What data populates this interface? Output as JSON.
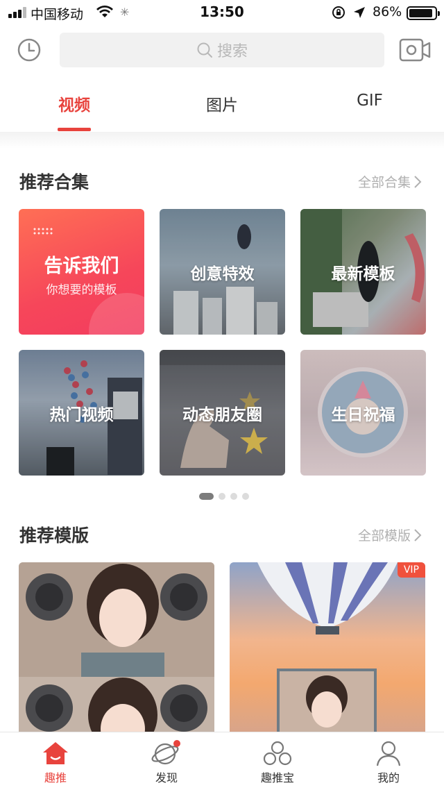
{
  "status_bar": {
    "carrier": "中国移动",
    "time": "13:50",
    "battery": "86%"
  },
  "search": {
    "placeholder": "搜索"
  },
  "tabs": [
    {
      "label": "视频",
      "active": true
    },
    {
      "label": "图片",
      "active": false
    },
    {
      "label": "GIF",
      "active": false
    }
  ],
  "collections": {
    "title": "推荐合集",
    "more": "全部合集",
    "feedback_card": {
      "title": "告诉我们",
      "subtitle": "你想要的模板"
    },
    "items": [
      {
        "label": "创意特效"
      },
      {
        "label": "最新模板"
      },
      {
        "label": "热门视频"
      },
      {
        "label": "动态朋友圈"
      },
      {
        "label": "生日祝福"
      }
    ],
    "page_count": 4,
    "current_page": 1
  },
  "templates": {
    "title": "推荐模版",
    "more": "全部模版",
    "badge": "VIP"
  },
  "bottom_nav": [
    {
      "label": "趣推",
      "icon": "home-icon",
      "active": true
    },
    {
      "label": "发现",
      "icon": "planet-icon",
      "active": false
    },
    {
      "label": "趣推宝",
      "icon": "circles-icon",
      "active": false
    },
    {
      "label": "我的",
      "icon": "user-icon",
      "active": false
    }
  ],
  "colors": {
    "accent": "#e8433d",
    "muted": "#b0b0b0"
  }
}
